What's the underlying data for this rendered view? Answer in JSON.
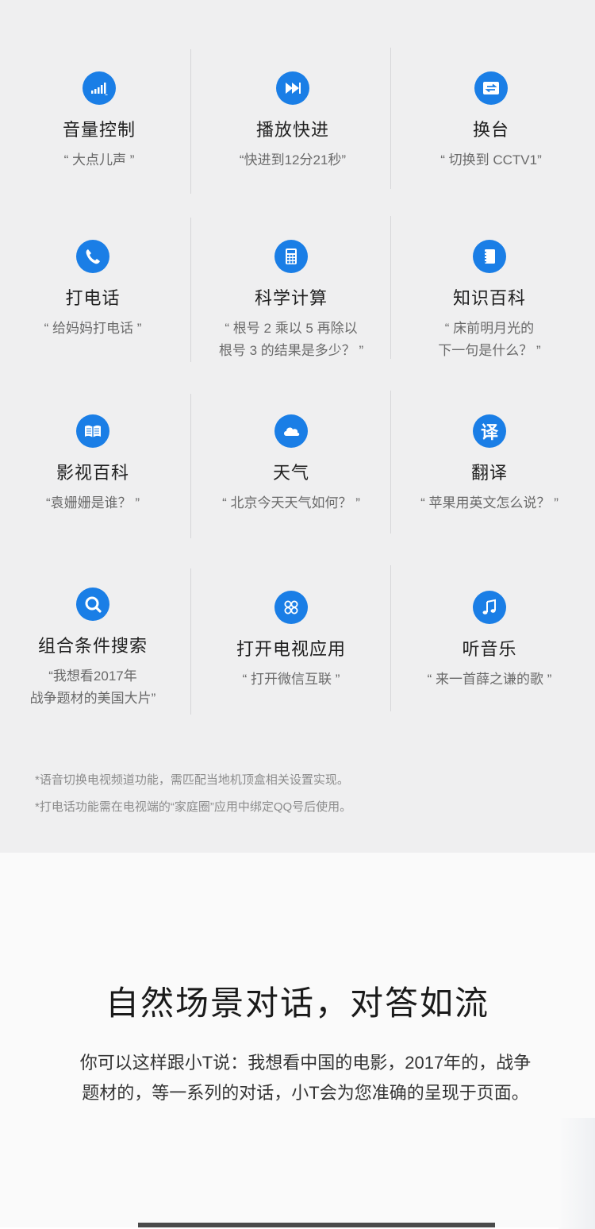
{
  "features": [
    {
      "icon": "volume-icon",
      "title": "音量控制",
      "desc": "“ 大点儿声 ”"
    },
    {
      "icon": "fast-forward-icon",
      "title": "播放快进",
      "desc": "“快进到12分21秒”"
    },
    {
      "icon": "channel-switch-icon",
      "title": "换台",
      "desc": "“ 切换到 CCTV1”"
    },
    {
      "icon": "phone-icon",
      "title": "打电话",
      "desc": "“ 给妈妈打电话 ”"
    },
    {
      "icon": "calculator-icon",
      "title": "科学计算",
      "desc": "“ 根号 2 乘以 5 再除以\n根号 3 的结果是多少？ ”"
    },
    {
      "icon": "encyclopedia-icon",
      "title": "知识百科",
      "desc": "“ 床前明月光的\n下一句是什么？ ”"
    },
    {
      "icon": "book-icon",
      "title": "影视百科",
      "desc": "“袁姗姗是谁？ ”"
    },
    {
      "icon": "cloud-icon",
      "title": "天气",
      "desc": "“ 北京今天天气如何？ ”"
    },
    {
      "icon": "translate-icon",
      "title": "翻译",
      "desc": "“ 苹果用英文怎么说？ ”"
    },
    {
      "icon": "search-icon",
      "title": "组合条件搜索",
      "desc": "“我想看2017年\n战争题材的美国大片”"
    },
    {
      "icon": "apps-icon",
      "title": "打开电视应用",
      "desc": "“ 打开微信互联 ”"
    },
    {
      "icon": "music-icon",
      "title": "听音乐",
      "desc": "“ 来一首薛之谦的歌 ”"
    }
  ],
  "translate_glyph": "译",
  "notes": [
    "*语音切换电视频道功能，需匹配当地机顶盒相关设置实现。",
    "*打电话功能需在电视端的“家庭圈”应用中绑定QQ号后使用。"
  ],
  "dialog": {
    "title": "自然场景对话，对答如流",
    "body": "你可以这样跟小T说：我想看中国的电影，2017年的，战争题材的，等一系列的对话，小T会为您准确的呈现于页面。"
  },
  "colors": {
    "accent": "#1a7ee6",
    "panel_bg": "#efeff0"
  }
}
